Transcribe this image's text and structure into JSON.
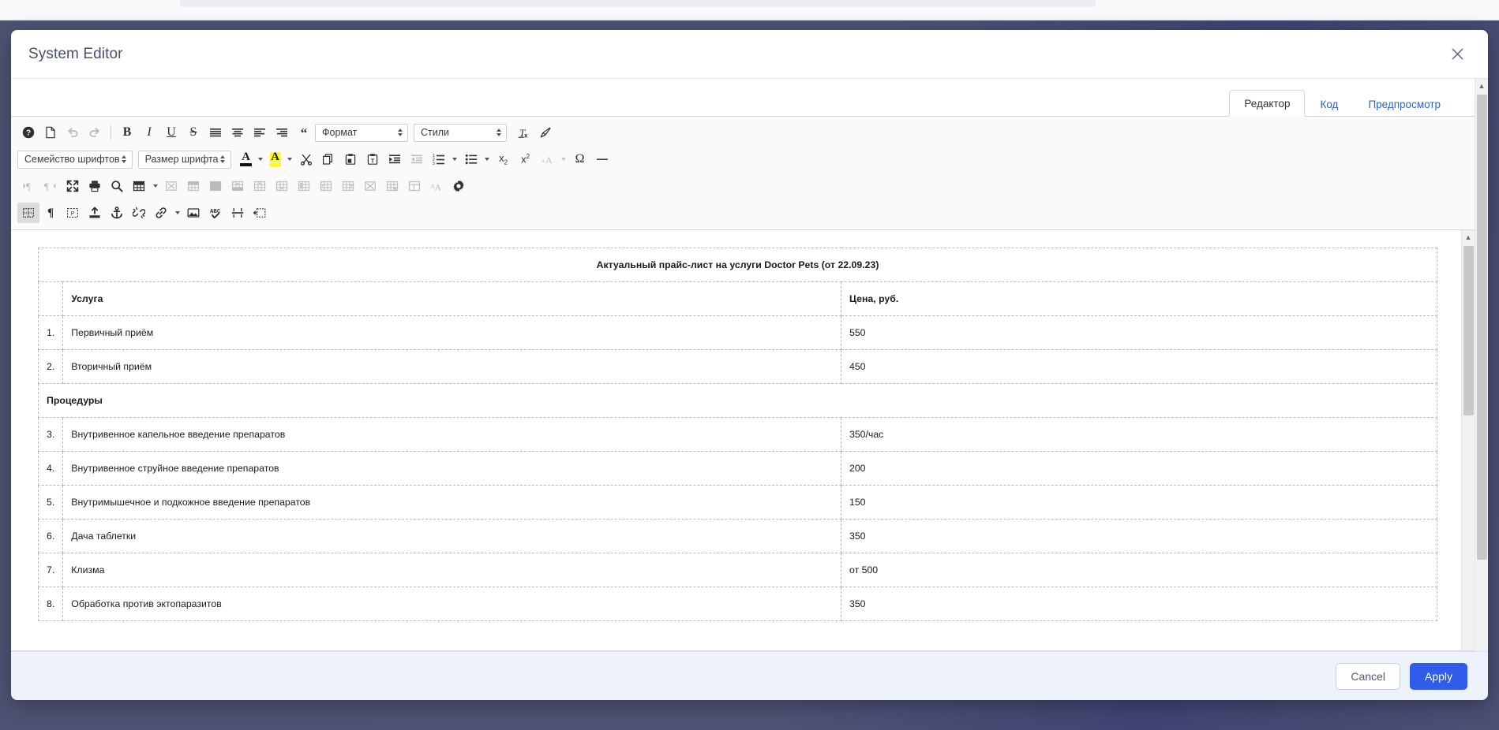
{
  "window": {
    "title": "System Editor",
    "close_icon": "close-icon"
  },
  "tabs": [
    {
      "label": "Редактор",
      "active": true
    },
    {
      "label": "Код",
      "active": false
    },
    {
      "label": "Предпросмотр",
      "active": false
    }
  ],
  "toolbar": {
    "rows": [
      {
        "name": "toolbar-row-1",
        "items": [
          {
            "type": "button",
            "name": "help-icon",
            "glyph": "help",
            "state": "normal",
            "title": "Справка"
          },
          {
            "type": "button",
            "name": "new-page-icon",
            "glyph": "page",
            "state": "normal",
            "title": "Новая страница"
          },
          {
            "type": "button",
            "name": "undo-icon",
            "glyph": "undo",
            "state": "dim",
            "title": "Отменить"
          },
          {
            "type": "button",
            "name": "redo-icon",
            "glyph": "redo",
            "state": "dim",
            "title": "Повторить"
          },
          {
            "type": "separator",
            "name": "toolbar-separator"
          },
          {
            "type": "button",
            "name": "bold-icon",
            "glyph": "bold",
            "state": "normal",
            "title": "Полужирный"
          },
          {
            "type": "button",
            "name": "italic-icon",
            "glyph": "italic",
            "state": "normal",
            "title": "Курсив"
          },
          {
            "type": "button",
            "name": "underline-icon",
            "glyph": "underline",
            "state": "normal",
            "title": "Подчёркнутый"
          },
          {
            "type": "button",
            "name": "strikethrough-icon",
            "glyph": "strike",
            "state": "normal",
            "title": "Зачёркнутый"
          },
          {
            "type": "button",
            "name": "align-justify-icon",
            "glyph": "just",
            "state": "normal",
            "title": "По ширине"
          },
          {
            "type": "button",
            "name": "align-center-icon",
            "glyph": "center",
            "state": "normal",
            "title": "По центру"
          },
          {
            "type": "button",
            "name": "align-left-icon",
            "glyph": "left",
            "state": "normal",
            "title": "По левому краю"
          },
          {
            "type": "button",
            "name": "align-right-icon",
            "glyph": "right",
            "state": "normal",
            "title": "По правому краю"
          },
          {
            "type": "button",
            "name": "blockquote-icon",
            "glyph": "quote",
            "state": "normal",
            "title": "Цитата"
          },
          {
            "type": "combo",
            "name": "format-select",
            "label": "Формат"
          },
          {
            "type": "combo",
            "name": "styles-select",
            "label": "Стили"
          },
          {
            "type": "button",
            "name": "remove-format-icon",
            "glyph": "removeformat",
            "state": "normal",
            "title": "Убрать форматирование"
          },
          {
            "type": "button",
            "name": "copy-formatting-icon",
            "glyph": "brush",
            "state": "normal",
            "title": "Копировать форматирование"
          }
        ]
      },
      {
        "name": "toolbar-row-2",
        "items": [
          {
            "type": "combo",
            "name": "font-family-select",
            "label": "Семейство шрифтов"
          },
          {
            "type": "combo",
            "name": "font-size-select",
            "label": "Размер шрифта"
          },
          {
            "type": "color",
            "name": "text-color-icon",
            "glyph": "A",
            "bar": "#111111",
            "highlight": false
          },
          {
            "type": "caret",
            "name": "text-color-chevron-down-icon",
            "state": "normal"
          },
          {
            "type": "color",
            "name": "background-color-icon",
            "glyph": "A",
            "bar": "#ffff00",
            "highlight": true
          },
          {
            "type": "caret",
            "name": "background-color-chevron-down-icon",
            "state": "normal"
          },
          {
            "type": "button",
            "name": "cut-icon",
            "glyph": "cut",
            "state": "normal",
            "title": "Вырезать"
          },
          {
            "type": "button",
            "name": "copy-icon",
            "glyph": "copy",
            "state": "normal",
            "title": "Копировать"
          },
          {
            "type": "button",
            "name": "paste-icon",
            "glyph": "paste",
            "state": "normal",
            "title": "Вставить"
          },
          {
            "type": "button",
            "name": "paste-text-icon",
            "glyph": "pastetext",
            "state": "normal",
            "title": "Вставить только текст"
          },
          {
            "type": "button",
            "name": "indent-increase-icon",
            "glyph": "indent",
            "state": "normal",
            "title": "Увеличить отступ"
          },
          {
            "type": "button",
            "name": "indent-decrease-icon",
            "glyph": "outdent",
            "state": "dim",
            "title": "Уменьшить отступ"
          },
          {
            "type": "button",
            "name": "numbered-list-icon",
            "glyph": "numlist",
            "state": "normal",
            "title": "Нумерованный список"
          },
          {
            "type": "caret",
            "name": "numbered-list-chevron-down-icon",
            "state": "normal"
          },
          {
            "type": "button",
            "name": "bulleted-list-icon",
            "glyph": "bullist",
            "state": "normal",
            "title": "Маркированный список"
          },
          {
            "type": "caret",
            "name": "bulleted-list-chevron-down-icon",
            "state": "normal"
          },
          {
            "type": "button",
            "name": "subscript-icon",
            "glyph": "sub",
            "state": "normal",
            "title": "Подстрочный"
          },
          {
            "type": "button",
            "name": "superscript-icon",
            "glyph": "sup",
            "state": "normal",
            "title": "Надстрочный"
          },
          {
            "type": "button",
            "name": "change-case-icon",
            "glyph": "case",
            "state": "dim",
            "title": "Регистр"
          },
          {
            "type": "caret",
            "name": "change-case-chevron-down-icon",
            "state": "dim"
          },
          {
            "type": "button",
            "name": "special-character-icon",
            "glyph": "omega",
            "state": "normal",
            "title": "Специальный символ"
          },
          {
            "type": "button",
            "name": "horizontal-rule-icon",
            "glyph": "hr",
            "state": "normal",
            "title": "Горизонтальная линия"
          }
        ]
      },
      {
        "name": "toolbar-row-3",
        "items": [
          {
            "type": "button",
            "name": "text-direction-ltr-icon",
            "glyph": "ltr",
            "state": "dim",
            "title": "Слева направо"
          },
          {
            "type": "button",
            "name": "text-direction-rtl-icon",
            "glyph": "rtl",
            "state": "dim",
            "title": "Справа налево"
          },
          {
            "type": "button",
            "name": "maximize-icon",
            "glyph": "maximize",
            "state": "normal",
            "title": "Развернуть"
          },
          {
            "type": "button",
            "name": "print-icon",
            "glyph": "print",
            "state": "normal",
            "title": "Печать"
          },
          {
            "type": "button",
            "name": "search-icon",
            "glyph": "search",
            "state": "normal",
            "title": "Найти"
          },
          {
            "type": "button",
            "name": "insert-table-icon",
            "glyph": "table",
            "state": "normal",
            "title": "Таблица"
          },
          {
            "type": "caret",
            "name": "insert-table-chevron-down-icon",
            "state": "normal"
          },
          {
            "type": "button",
            "name": "delete-table-icon",
            "glyph": "tbl-del",
            "state": "dim",
            "title": "Удалить таблицу"
          },
          {
            "type": "button",
            "name": "table-row-select-icon",
            "glyph": "tbl-rowsel",
            "state": "dim",
            "title": "Выделить строку"
          },
          {
            "type": "button",
            "name": "table-grid-icon",
            "glyph": "tbl-grid",
            "state": "dim",
            "title": "Свойства таблицы"
          },
          {
            "type": "button",
            "name": "insert-row-above-icon",
            "glyph": "tbl-rowup",
            "state": "dim",
            "title": "Вставить строку сверху"
          },
          {
            "type": "button",
            "name": "insert-row-below-icon",
            "glyph": "tbl-rowdn",
            "state": "dim",
            "title": "Вставить строку снизу"
          },
          {
            "type": "button",
            "name": "insert-row-icon",
            "glyph": "tbl-rowplus",
            "state": "dim",
            "title": "Вставить строку"
          },
          {
            "type": "button",
            "name": "delete-row-icon",
            "glyph": "tbl-rowdel",
            "state": "dim",
            "title": "Удалить строку"
          },
          {
            "type": "button",
            "name": "insert-column-left-icon",
            "glyph": "tbl-colleft",
            "state": "dim",
            "title": "Вставить столбец слева"
          },
          {
            "type": "button",
            "name": "insert-column-right-icon",
            "glyph": "tbl-colright",
            "state": "dim",
            "title": "Вставить столбец справа"
          },
          {
            "type": "button",
            "name": "delete-cell-icon",
            "glyph": "tbl-celldel",
            "state": "dim",
            "title": "Удалить ячейку"
          },
          {
            "type": "button",
            "name": "merge-cells-icon",
            "glyph": "tbl-merge",
            "state": "dim",
            "title": "Объединить ячейки"
          },
          {
            "type": "button",
            "name": "split-cell-icon",
            "glyph": "tbl-split",
            "state": "dim",
            "title": "Разбить ячейку"
          },
          {
            "type": "button",
            "name": "autoformat-icon",
            "glyph": "aA",
            "state": "dim",
            "title": "Автоформат"
          },
          {
            "type": "button",
            "name": "settings-gear-icon",
            "glyph": "gear",
            "state": "normal",
            "title": "Настройки"
          }
        ]
      },
      {
        "name": "toolbar-row-4",
        "items": [
          {
            "type": "button",
            "name": "show-borders-icon",
            "glyph": "borders",
            "state": "on",
            "title": "Показать границы"
          },
          {
            "type": "button",
            "name": "show-blocks-icon",
            "glyph": "pilcrow",
            "state": "normal",
            "title": "Показать блоки"
          },
          {
            "type": "button",
            "name": "placeholder-icon",
            "glyph": "placeholder",
            "state": "normal",
            "title": "Заполнитель"
          },
          {
            "type": "button",
            "name": "upload-icon",
            "glyph": "upload",
            "state": "normal",
            "title": "Загрузить файл"
          },
          {
            "type": "button",
            "name": "anchor-icon",
            "glyph": "anchor",
            "state": "normal",
            "title": "Якорь"
          },
          {
            "type": "button",
            "name": "unlink-icon",
            "glyph": "unlink",
            "state": "normal",
            "title": "Убрать ссылку"
          },
          {
            "type": "button",
            "name": "link-icon",
            "glyph": "link",
            "state": "normal",
            "title": "Ссылка"
          },
          {
            "type": "caret",
            "name": "link-chevron-down-icon",
            "state": "normal"
          },
          {
            "type": "button",
            "name": "image-icon",
            "glyph": "image",
            "state": "normal",
            "title": "Изображение"
          },
          {
            "type": "button",
            "name": "spellcheck-icon",
            "glyph": "spell",
            "state": "normal",
            "title": "Проверка орфографии"
          },
          {
            "type": "button",
            "name": "page-break-icon",
            "glyph": "pagebreak",
            "state": "normal",
            "title": "Разрыв страницы"
          },
          {
            "type": "button",
            "name": "iframe-icon",
            "glyph": "iframe",
            "state": "normal",
            "title": "IFrame"
          }
        ]
      }
    ]
  },
  "document": {
    "title_row": "Актуальный прайс-лист на услуги Doctor Pets (от 22.09.23)",
    "columns": [
      "Услуга",
      "Цена, руб."
    ],
    "rows": [
      {
        "type": "item",
        "num": "1.",
        "service": "Первичный приём",
        "price": "550"
      },
      {
        "type": "item",
        "num": "2.",
        "service": "Вторичный приём",
        "price": "450"
      },
      {
        "type": "section",
        "num": "",
        "service": "Процедуры",
        "price": ""
      },
      {
        "type": "item",
        "num": "3.",
        "service": "Внутривенное капельное введение препаратов",
        "price": "350/час"
      },
      {
        "type": "item",
        "num": "4.",
        "service": "Внутривенное струйное введение препаратов",
        "price": "200"
      },
      {
        "type": "item",
        "num": "5.",
        "service": "Внутримышечное и подкожное введение препаратов",
        "price": "150"
      },
      {
        "type": "item",
        "num": "6.",
        "service": "Дача таблетки",
        "price": "350"
      },
      {
        "type": "item",
        "num": "7.",
        "service": "Клизма",
        "price": "от 500"
      },
      {
        "type": "item",
        "num": "8.",
        "service": "Обработка против эктопаразитов",
        "price": "350"
      }
    ]
  },
  "footer": {
    "cancel_label": "Cancel",
    "apply_label": "Apply"
  },
  "colors": {
    "primary": "#2f5ce8",
    "backdrop": "#4f5374",
    "tab_link": "#2f63c6",
    "title_text": "#4a4f6b"
  }
}
